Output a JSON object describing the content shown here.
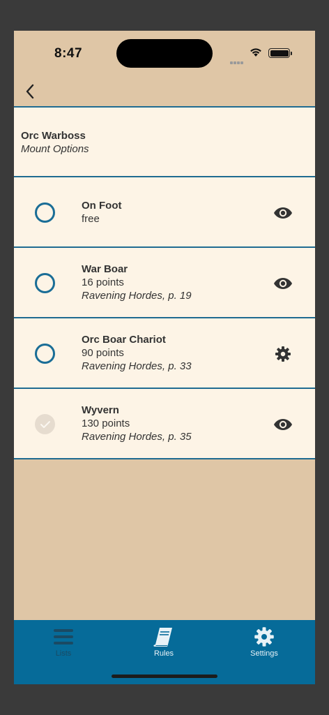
{
  "status_bar": {
    "time": "8:47"
  },
  "header": {
    "title": "Orc Warboss",
    "subtitle": "Mount Options"
  },
  "options": [
    {
      "name": "On Foot",
      "cost": "free",
      "reference": "",
      "selected": false,
      "action_icon": "eye-icon"
    },
    {
      "name": "War Boar",
      "cost": "16 points",
      "reference": "Ravening Hordes, p. 19",
      "selected": false,
      "action_icon": "eye-icon"
    },
    {
      "name": "Orc Boar Chariot",
      "cost": "90 points",
      "reference": "Ravening Hordes, p. 33",
      "selected": false,
      "action_icon": "gear-icon"
    },
    {
      "name": "Wyvern",
      "cost": "130 points",
      "reference": "Ravening Hordes, p. 35",
      "selected": true,
      "action_icon": "eye-icon"
    }
  ],
  "tabs": [
    {
      "label": "Lists",
      "icon": "list-icon",
      "active": false
    },
    {
      "label": "Rules",
      "icon": "book-icon",
      "active": true
    },
    {
      "label": "Settings",
      "icon": "gear-icon",
      "active": true
    }
  ],
  "colors": {
    "background": "#dfc6a6",
    "card": "#fdf4e6",
    "accent": "#1a6d96",
    "tab_bar": "#066b99"
  }
}
